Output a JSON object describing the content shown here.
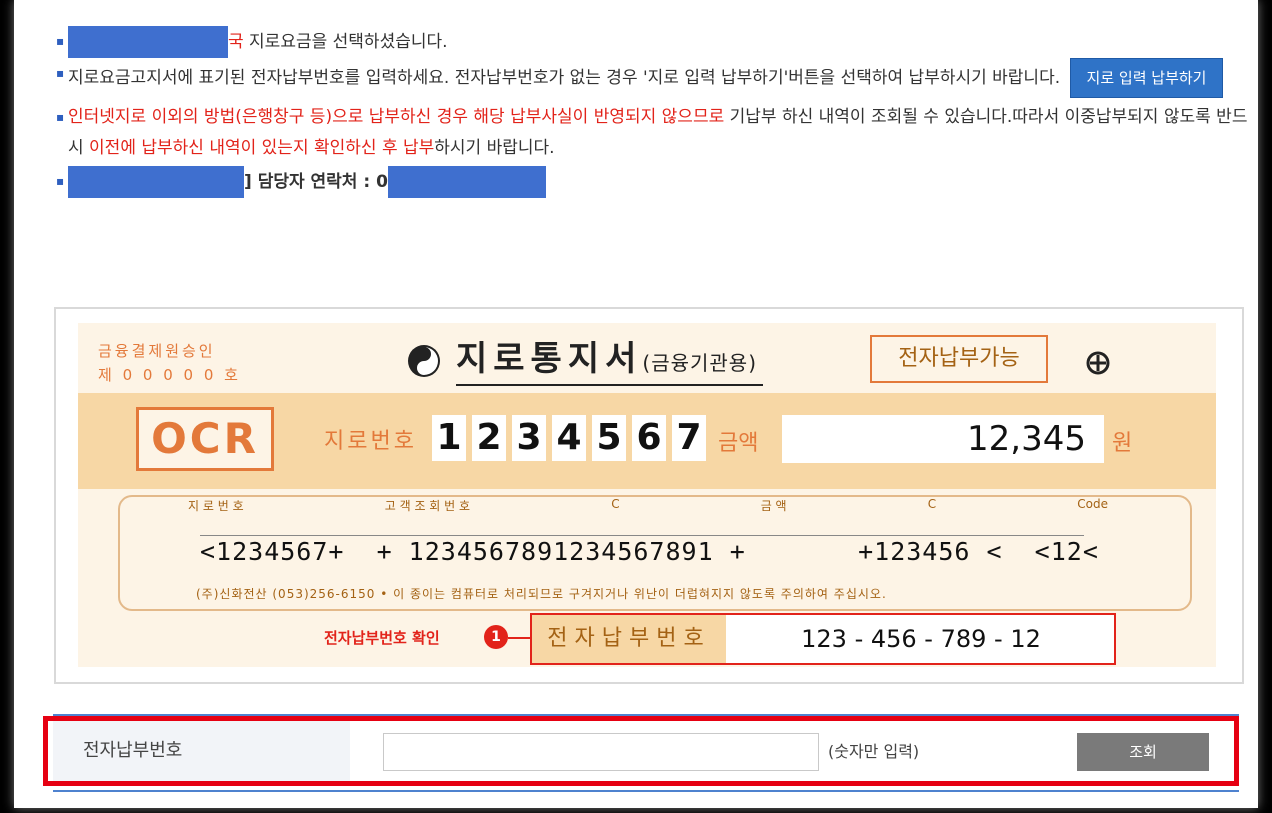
{
  "notes": {
    "line1_suffix": "국",
    "line1_text": " 지로요금을 선택하셨습니다.",
    "line2_text": "지로요금고지서에 표기된 전자납부번호를 입력하세요. 전자납부번호가 없는 경우 '지로 입력 납부하기'버튼을 선택하여 납부하시기 바랍니다.",
    "giro_button": "지로 입력 납부하기",
    "line3_red1": "인터넷지로 이외의 방법(은행창구 등)으로 납부하신 경우 해당 납부사실이 반영되지 않으므로",
    "line3_text1": " 기납부 하신 내역이 조회될 수 있습니다.따라서 이중납부되지 않도록 반드시 ",
    "line3_red2": "이전에 납부하신 내역이 있는지 확인하신 후 납부",
    "line3_text2": "하시기 바랍니다.",
    "line4_text": "] 담당자 연락처 : 0"
  },
  "slip": {
    "approval": "금융결제원승인\n제 0 0 0 0 0 호",
    "title": "지로통지서",
    "title_sub": "(금융기관용)",
    "epay_tag": "전자납부가능",
    "ocr": "OCR",
    "giro_label": "지로번호",
    "giro_digits": [
      "1",
      "2",
      "3",
      "4",
      "5",
      "6",
      "7"
    ],
    "amount_label": "금액",
    "amount": "12,345",
    "won": "원",
    "code_headers": [
      "지 로 번 호",
      "고 객 조 회 번 호",
      "C",
      "금 액",
      "C",
      "Code"
    ],
    "code_line": "<1234567+  + 1234567891234567891 +       +123456 <  <12<",
    "disclaimer": "(주)신화전산 (053)256-6150  • 이 종이는 컴퓨터로 처리되므로 구겨지거나 위난이 더럽혀지지 않도록 주의하여 주십시오.",
    "check_label": "전자납부번호 확인",
    "badge": "1",
    "epay_label": "전자납부번호",
    "epay_number": "123 - 456 - 789 - 12"
  },
  "form": {
    "label": "전자납부번호",
    "input_value": "",
    "input_placeholder": "",
    "hint": "(숫자만 입력)",
    "search_button": "조회"
  },
  "colors": {
    "accent_blue": "#2f73c7",
    "warning_red": "#e2231a",
    "slip_orange": "#e3793a",
    "highlight_red": "#e60012"
  }
}
